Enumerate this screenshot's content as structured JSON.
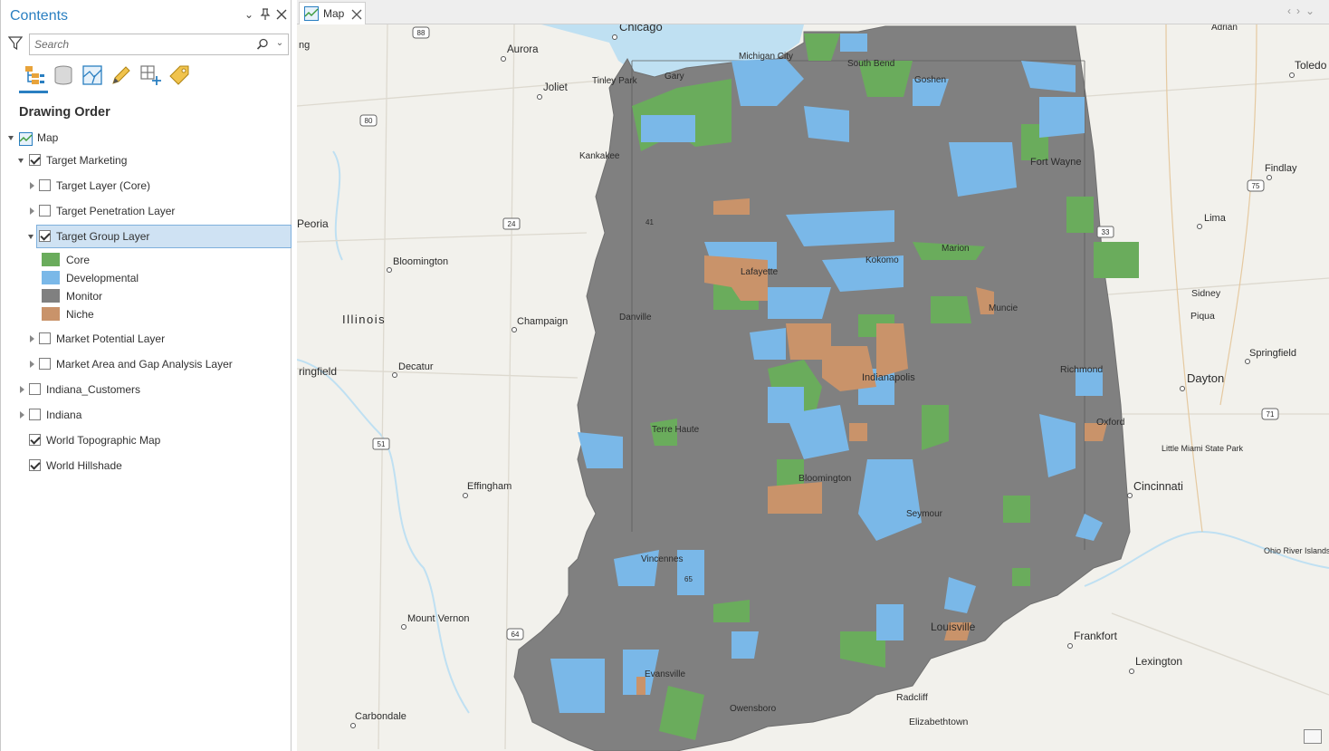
{
  "contents": {
    "title": "Contents",
    "search_placeholder": "Search",
    "section_title": "Drawing Order",
    "layers": {
      "map": "Map",
      "target_marketing": "Target Marketing",
      "target_layer_core": "Target Layer (Core)",
      "target_penetration": "Target Penetration Layer",
      "target_group": "Target Group Layer",
      "market_potential": "Market Potential Layer",
      "market_area_gap": "Market Area and Gap Analysis Layer",
      "indiana_customers": "Indiana_Customers",
      "indiana": "Indiana",
      "world_topo": "World Topographic Map",
      "world_hillshade": "World Hillshade"
    },
    "legend": [
      {
        "label": "Core",
        "color": "#6aac5c"
      },
      {
        "label": "Developmental",
        "color": "#7ab8e8"
      },
      {
        "label": "Monitor",
        "color": "#808080"
      },
      {
        "label": "Niche",
        "color": "#c9936a"
      }
    ]
  },
  "map_tab": {
    "label": "Map"
  },
  "map": {
    "places": {
      "chicago": "Chicago",
      "aurora": "Aurora",
      "joliet": "Joliet",
      "tinley_park": "Tinley Park",
      "gary": "Gary",
      "michigan_city": "Michigan City",
      "south_bend": "South Bend",
      "goshen": "Goshen",
      "adrian": "Adrian",
      "toledo": "Toledo",
      "kankakee": "Kankakee",
      "fort_wayne": "Fort Wayne",
      "findlay": "Findlay",
      "peoria": "Peoria",
      "lima": "Lima",
      "bloomington_il": "Bloomington",
      "lafayette": "Lafayette",
      "kokomo": "Kokomo",
      "muncie": "Muncie",
      "marion": "Marion",
      "sidney": "Sidney",
      "piqua": "Piqua",
      "illinois": "Illinois",
      "champaign": "Champaign",
      "danville": "Danville",
      "springfield_oh": "Springfield",
      "springfield_il": "ringfield",
      "decatur": "Decatur",
      "indianapolis": "Indianapolis",
      "richmond": "Richmond",
      "dayton": "Dayton",
      "terre_haute": "Terre Haute",
      "oxford": "Oxford",
      "little_miami": "Little Miami State Park",
      "effingham": "Effingham",
      "bloomington_in": "Bloomington",
      "cincinnati": "Cincinnati",
      "seymour": "Seymour",
      "vincennes": "Vincennes",
      "ohio_river": "Ohio River Islands National Wildlife Refuge",
      "mount_vernon": "Mount Vernon",
      "louisville": "Louisville",
      "frankfort": "Frankfort",
      "lexington": "Lexington",
      "radcliff": "Radcliff",
      "carbondale": "Carbondale",
      "elizabethtown": "Elizabethtown",
      "evansville": "Evansville",
      "owensboro": "Owensboro",
      "ng": "ng"
    },
    "shields": [
      "88",
      "80",
      "24",
      "33",
      "75",
      "51",
      "71",
      "64",
      "41",
      "65"
    ]
  }
}
